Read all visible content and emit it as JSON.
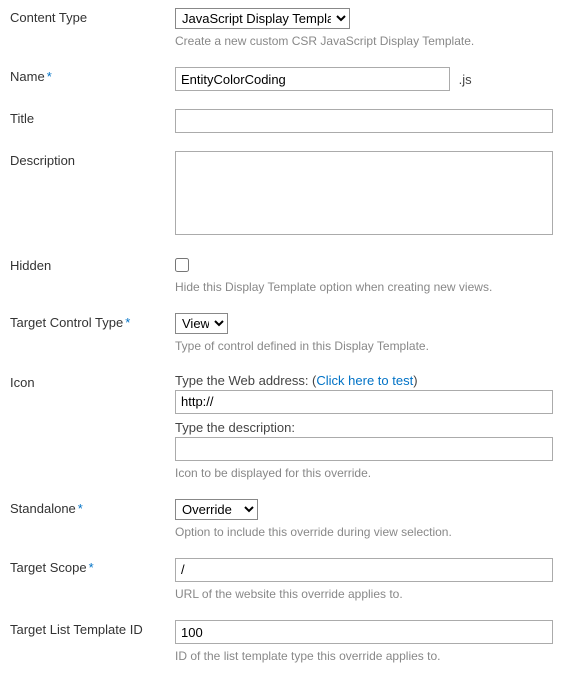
{
  "contentType": {
    "label": "Content Type",
    "value": "JavaScript Display Template",
    "help": "Create a new custom CSR JavaScript Display Template."
  },
  "name": {
    "label": "Name",
    "value": "EntityColorCoding",
    "ext": ".js"
  },
  "title": {
    "label": "Title",
    "value": ""
  },
  "description": {
    "label": "Description",
    "value": ""
  },
  "hidden": {
    "label": "Hidden",
    "help": "Hide this Display Template option when creating new views."
  },
  "targetControlType": {
    "label": "Target Control Type",
    "value": "View",
    "help": "Type of control defined in this Display Template."
  },
  "icon": {
    "label": "Icon",
    "pre": "Type the Web address: (",
    "linkText": "Click here to test",
    "post": ")",
    "urlValue": "http://",
    "descLabel": "Type the description:",
    "descValue": "",
    "help": "Icon to be displayed for this override."
  },
  "standalone": {
    "label": "Standalone",
    "value": "Override",
    "help": "Option to include this override during view selection."
  },
  "targetScope": {
    "label": "Target Scope",
    "value": "/",
    "help": "URL of the website this override applies to."
  },
  "targetListTemplateId": {
    "label": "Target List Template ID",
    "value": "100",
    "help": "ID of the list template type this override applies to."
  },
  "requiredMark": "*"
}
